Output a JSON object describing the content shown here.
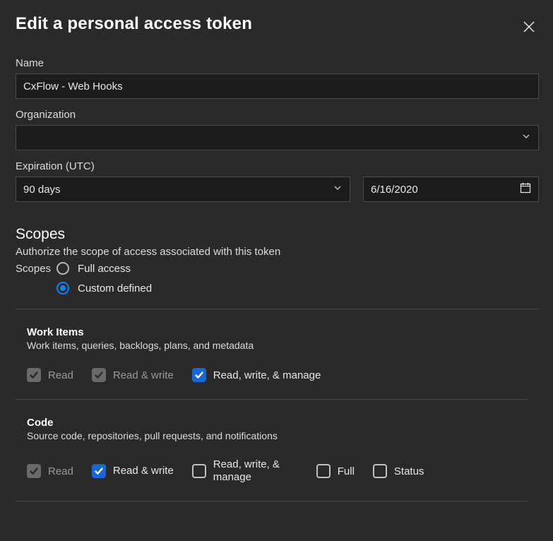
{
  "header": {
    "title": "Edit a personal access token"
  },
  "name": {
    "label": "Name",
    "value": "CxFlow - Web Hooks"
  },
  "organization": {
    "label": "Organization",
    "value": ""
  },
  "expiration": {
    "label": "Expiration (UTC)",
    "duration": "90 days",
    "date": "6/16/2020"
  },
  "scopes": {
    "title": "Scopes",
    "subtitle": "Authorize the scope of access associated with this token",
    "inline_label": "Scopes",
    "options": {
      "full": "Full access",
      "custom": "Custom defined"
    },
    "selected": "custom",
    "groups": [
      {
        "name": "Work Items",
        "desc": "Work items, queries, backlogs, plans, and metadata",
        "perms": [
          {
            "label": "Read",
            "state": "disabled-checked"
          },
          {
            "label": "Read & write",
            "state": "disabled-checked"
          },
          {
            "label": "Read, write, & manage",
            "state": "active-checked"
          }
        ]
      },
      {
        "name": "Code",
        "desc": "Source code, repositories, pull requests, and notifications",
        "perms": [
          {
            "label": "Read",
            "state": "disabled-checked"
          },
          {
            "label": "Read & write",
            "state": "active-checked",
            "wrap": true
          },
          {
            "label": "Read, write, & manage",
            "state": "empty",
            "wrap": true
          },
          {
            "label": "Full",
            "state": "empty"
          },
          {
            "label": "Status",
            "state": "empty"
          }
        ]
      }
    ]
  }
}
